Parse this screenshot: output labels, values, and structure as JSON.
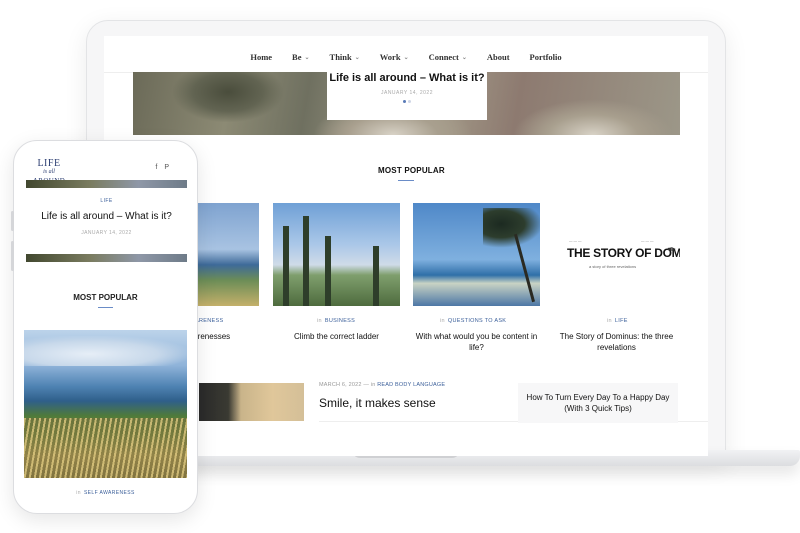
{
  "nav": {
    "items": [
      {
        "label": "Home",
        "has_caret": false
      },
      {
        "label": "Be",
        "has_caret": true
      },
      {
        "label": "Think",
        "has_caret": true
      },
      {
        "label": "Work",
        "has_caret": true
      },
      {
        "label": "Connect",
        "has_caret": true
      },
      {
        "label": "About",
        "has_caret": false
      },
      {
        "label": "Portfolio",
        "has_caret": false
      }
    ]
  },
  "hero": {
    "title": "Life is all around – What is it?",
    "date": "JANUARY 14, 2022",
    "slides": 2,
    "active_slide": 1
  },
  "most_popular": {
    "heading": "MOST POPULAR",
    "posts": [
      {
        "category": "AWARENESS",
        "title": "awarenesses"
      },
      {
        "category": "BUSINESS",
        "title": "Climb the correct ladder"
      },
      {
        "category": "QUESTIONS TO ASK",
        "title": "With what would you be content in life?"
      },
      {
        "category": "LIFE",
        "title": "The Story of Dominus: the three revelations"
      }
    ],
    "in_label": "in"
  },
  "book_cover": {
    "title": "THE STORY OF DOMINUS",
    "subtitle": "a story of three revelations"
  },
  "featured": {
    "date": "MARCH 6, 2022",
    "separator": "—",
    "in_label": "in",
    "category": "READ BODY LANGUAGE",
    "title": "Smile, it makes sense",
    "side_title": "How To Turn Every Day To a Happy Day (With 3 Quick Tips)"
  },
  "phone": {
    "logo": {
      "line1": "LIFE",
      "line2": "is all",
      "line3": "AROUND"
    },
    "social": {
      "facebook": "f",
      "pinterest": "P"
    },
    "hero_category": "LIFE",
    "hero_title": "Life is all around – What is it?",
    "hero_date": "JANUARY 14, 2022",
    "section_heading": "MOST POPULAR",
    "post_in_label": "in",
    "post_category": "SELF AWARENESS"
  },
  "colors": {
    "accent": "#3b5f9a",
    "rule": "#6a8cc7",
    "logo": "#2c3e72"
  }
}
